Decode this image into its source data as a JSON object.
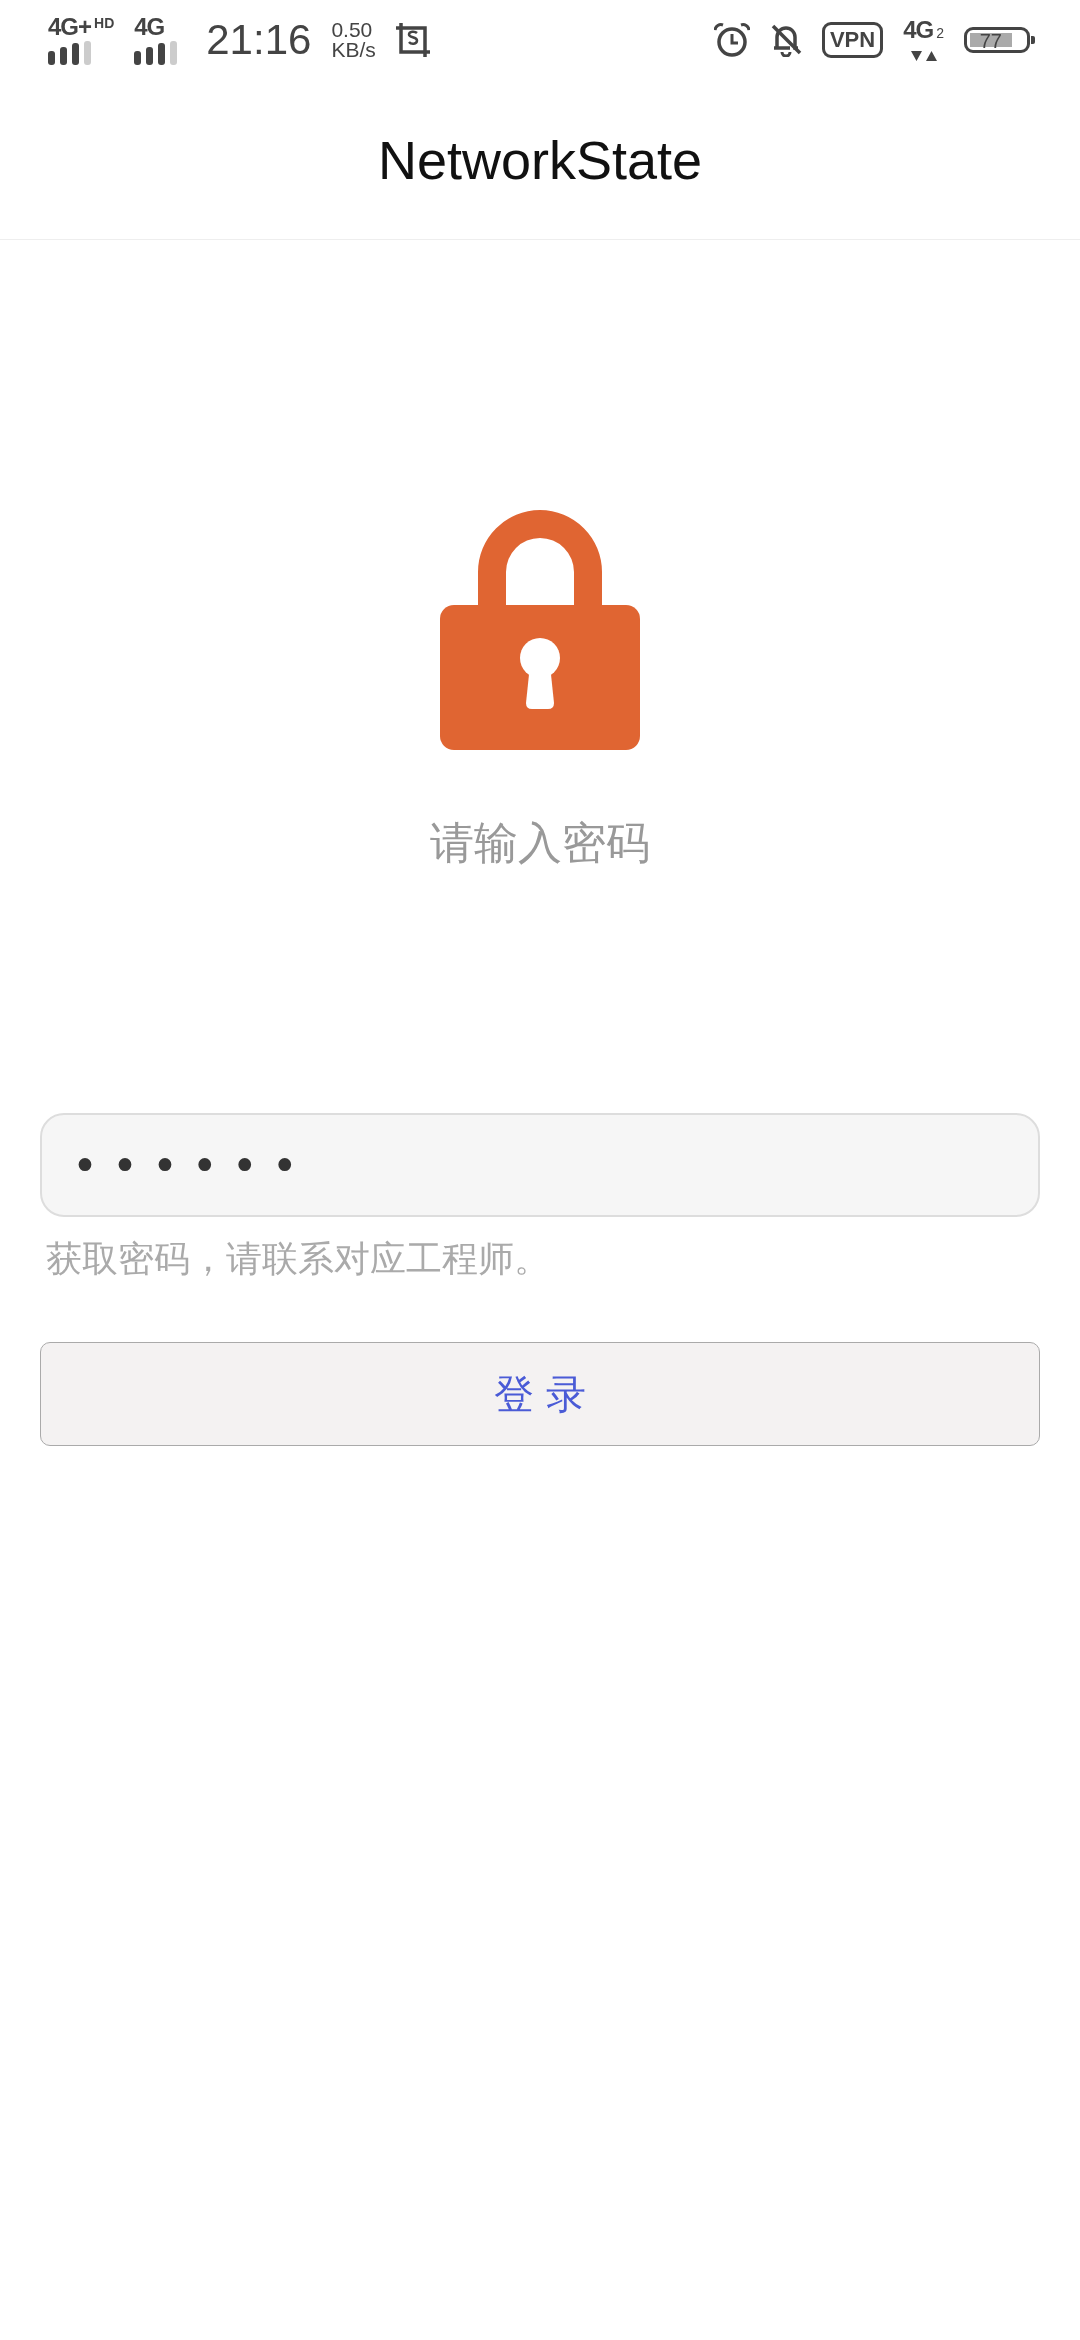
{
  "status_bar": {
    "sim1": {
      "network": "4G+",
      "hd": "HD"
    },
    "sim2": {
      "network": "4G"
    },
    "time": "21:16",
    "speed": {
      "value": "0.50",
      "unit": "KB/s"
    },
    "vpn": "VPN",
    "data_network": "4G",
    "data_sim": "2",
    "battery": "77"
  },
  "header": {
    "title": "NetworkState"
  },
  "prompt": "请输入密码",
  "password_field": {
    "value": "••••••"
  },
  "hint": "获取密码，请联系对应工程师。",
  "login_button": {
    "label": "登 录"
  }
}
